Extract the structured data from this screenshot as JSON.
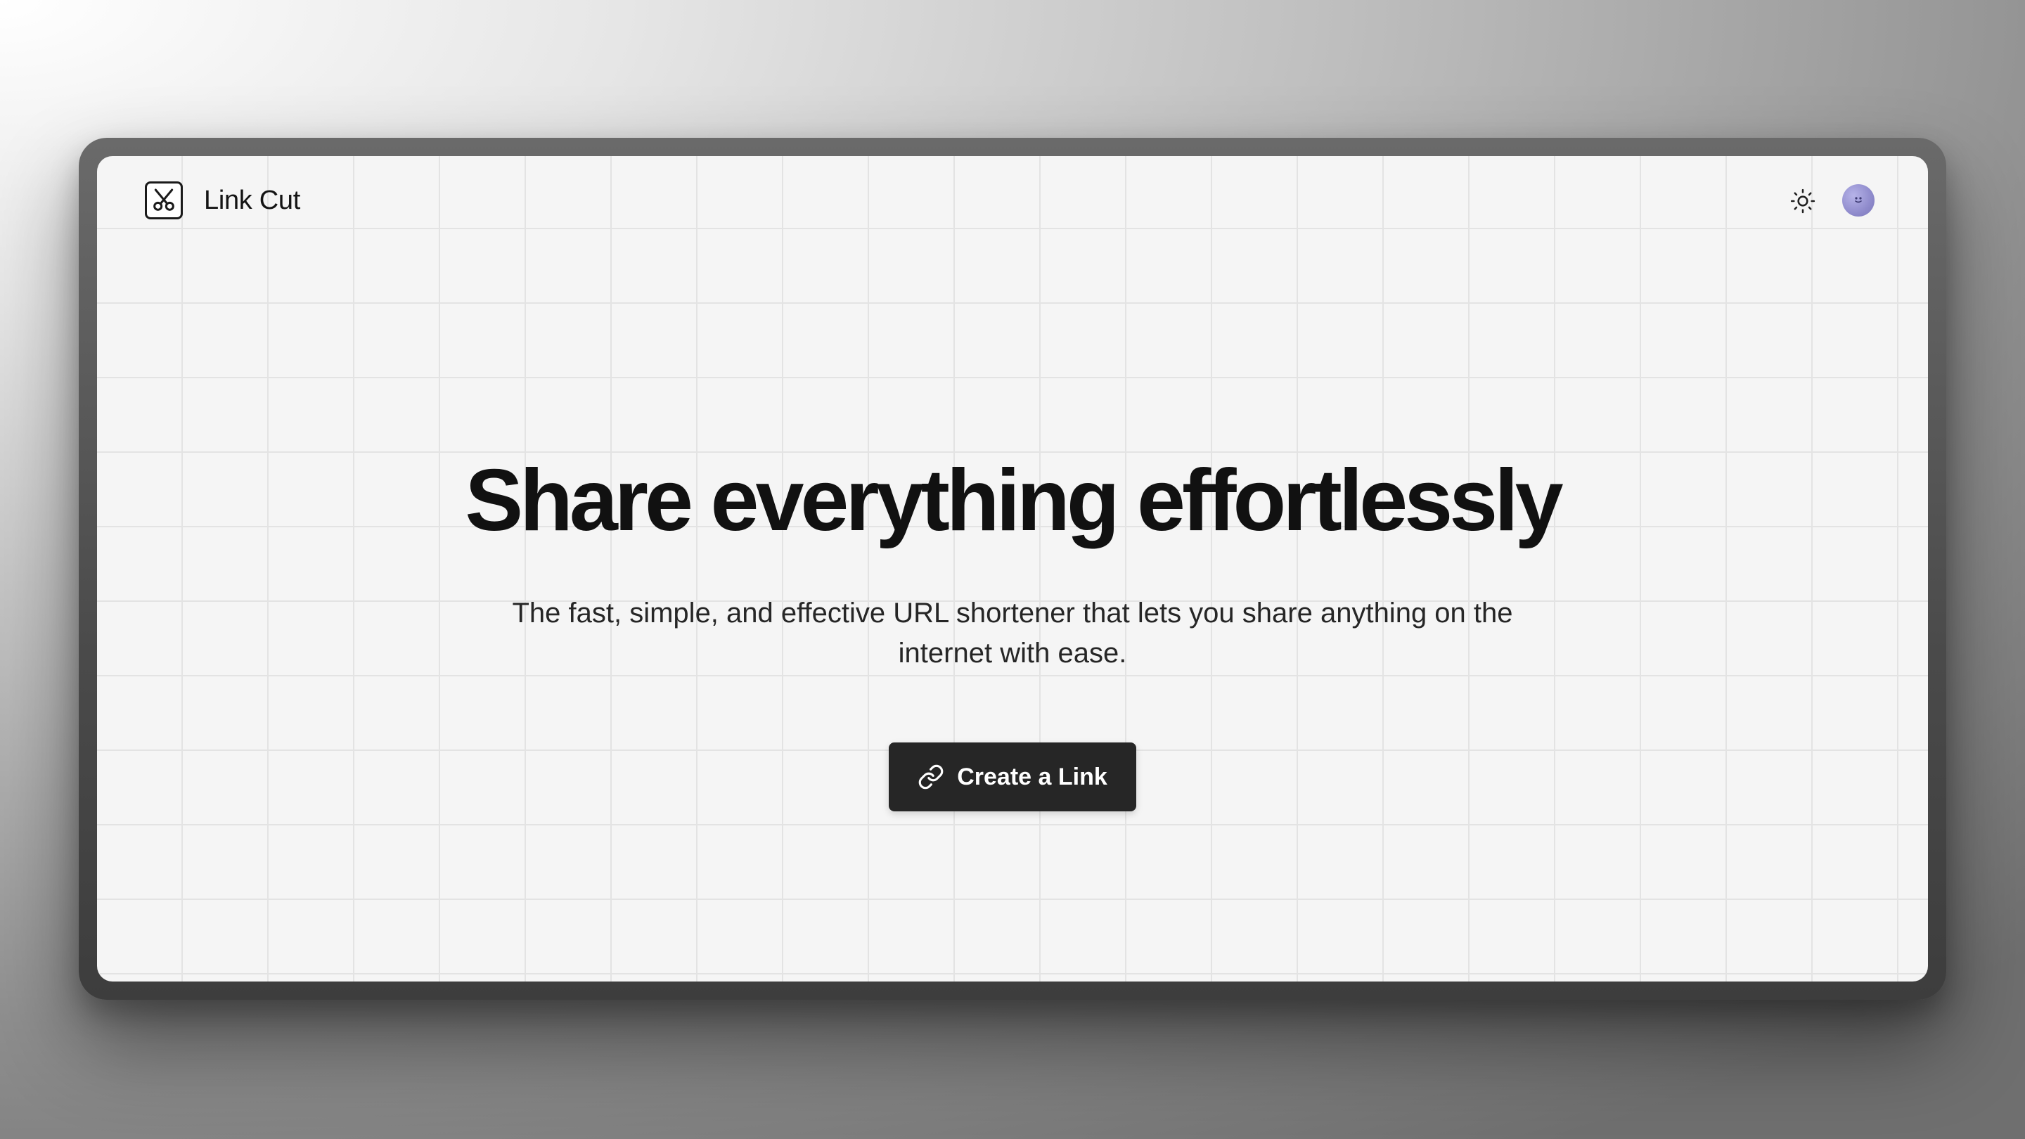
{
  "brand": {
    "name": "Link Cut",
    "logo_icon": "scissors-icon"
  },
  "header": {
    "theme_toggle_icon": "sun-icon",
    "avatar_icon": "user-avatar"
  },
  "hero": {
    "title": "Share everything effortlessly",
    "subtitle": "The fast, simple, and effective URL shortener that lets you share anything on the internet with ease.",
    "cta_label": "Create a Link",
    "cta_icon": "link-icon"
  },
  "colors": {
    "button_bg": "#262626",
    "button_text": "#ffffff",
    "avatar": "#8f8bcc",
    "page_bg": "#f5f5f5"
  }
}
